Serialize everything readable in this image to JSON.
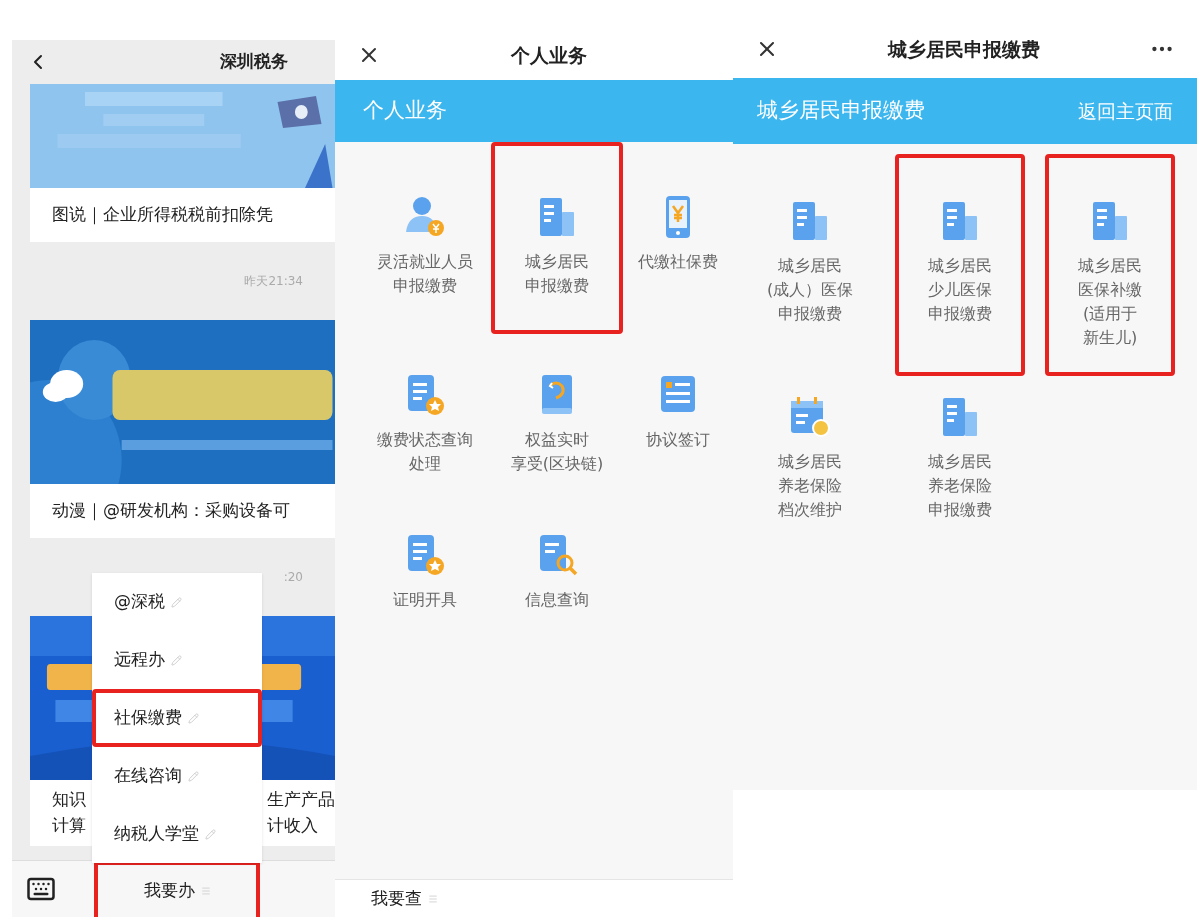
{
  "chat": {
    "title": "深圳税务",
    "messages": [
      {
        "kind": "article",
        "caption_lines": [
          "图说｜企业所得税税前扣除凭"
        ]
      },
      {
        "kind": "time",
        "text": "昨天21:34"
      },
      {
        "kind": "article",
        "caption_lines": [
          "动漫｜@研发机构：采购设备可"
        ]
      },
      {
        "kind": "time",
        "text": ":20"
      },
      {
        "kind": "split_article",
        "left_lines": [
          "知识",
          "计算"
        ],
        "right_lines": [
          "生产产品",
          "计收入"
        ]
      }
    ],
    "menu": [
      {
        "label": "@深税",
        "highlighted": false
      },
      {
        "label": "远程办",
        "highlighted": false
      },
      {
        "label": "社保缴费",
        "highlighted": true
      },
      {
        "label": "在线咨询",
        "highlighted": false
      },
      {
        "label": "纳税人学堂",
        "highlighted": false
      }
    ],
    "bottom_tab": {
      "label": "我要办",
      "highlighted": true
    }
  },
  "personal": {
    "title": "个人业务",
    "banner": "个人业务",
    "items": [
      {
        "kind": "person_coin",
        "lines": [
          "灵活就业人员",
          "申报缴费"
        ],
        "highlighted": false
      },
      {
        "kind": "building",
        "lines": [
          "城乡居民",
          "申报缴费"
        ],
        "highlighted": true
      },
      {
        "kind": "phone_yen",
        "lines": [
          "代缴社保费"
        ],
        "highlighted": false
      },
      {
        "kind": "doc_star",
        "lines": [
          "缴费状态查询",
          "处理"
        ],
        "highlighted": false
      },
      {
        "kind": "book",
        "lines": [
          "权益实时",
          "享受(区块链)"
        ],
        "highlighted": false
      },
      {
        "kind": "card",
        "lines": [
          "协议签订"
        ],
        "highlighted": false
      },
      {
        "kind": "doc_star",
        "lines": [
          "证明开具"
        ],
        "highlighted": false
      },
      {
        "kind": "doc_search",
        "lines": [
          "信息查询"
        ],
        "highlighted": false
      }
    ],
    "bottom_tab": {
      "label": "我要查",
      "highlighted": false
    }
  },
  "residents": {
    "title": "城乡居民申报缴费",
    "banner": "城乡居民申报缴费",
    "back_link": "返回主页面",
    "items": [
      {
        "kind": "building",
        "lines": [
          "城乡居民",
          "(成人）医保",
          "申报缴费"
        ],
        "highlighted": false
      },
      {
        "kind": "building",
        "lines": [
          "城乡居民",
          "少儿医保",
          "申报缴费"
        ],
        "highlighted": true
      },
      {
        "kind": "building",
        "lines": [
          "城乡居民",
          "医保补缴",
          "(适用于",
          "新生儿)"
        ],
        "highlighted": true
      },
      {
        "kind": "calendar_coin",
        "lines": [
          "城乡居民",
          "养老保险",
          "档次维护"
        ],
        "highlighted": false
      },
      {
        "kind": "building",
        "lines": [
          "城乡居民",
          "养老保险",
          "申报缴费"
        ],
        "highlighted": false
      }
    ]
  }
}
